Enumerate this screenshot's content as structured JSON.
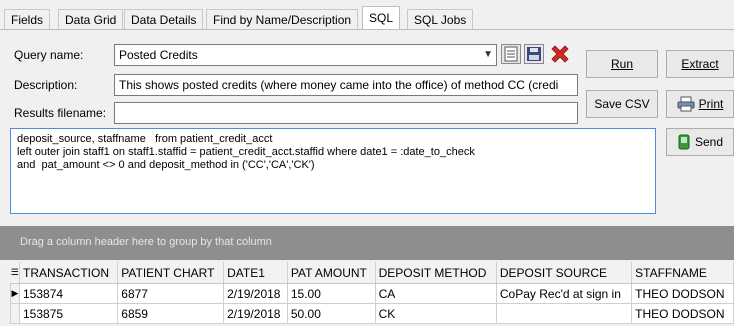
{
  "tabs": [
    {
      "label": "Fields"
    },
    {
      "label": "Data Grid"
    },
    {
      "label": "Data Details"
    },
    {
      "label": "Find by Name/Description"
    },
    {
      "label": "SQL"
    },
    {
      "label": "SQL Jobs"
    }
  ],
  "form": {
    "query_name_label": "Query name:",
    "query_name_value": "Posted Credits",
    "description_label": "Description:",
    "description_value": "This shows posted credits (where money came into the office) of method CC (credi",
    "results_filename_label": "Results filename:",
    "results_filename_value": ""
  },
  "buttons": {
    "run": "Run",
    "extract": "Extract",
    "save_csv": "Save CSV",
    "print": "Print",
    "send": "Send"
  },
  "sql_text": "deposit_source, staffname   from patient_credit_acct\nleft outer join staff1 on staff1.staffid = patient_credit_acct.staffid where date1 = :date_to_check\nand  pat_amount <> 0 and deposit_method in ('CC','CA','CK')",
  "group_hint": "Drag a column header here to group by that column",
  "grid": {
    "headers": [
      "TRANSACTION",
      "PATIENT CHART",
      "DATE1",
      "PAT AMOUNT",
      "DEPOSIT METHOD",
      "DEPOSIT SOURCE",
      "STAFFNAME"
    ],
    "rows": [
      [
        "153874",
        "6877",
        "2/19/2018",
        "15.00",
        "CA",
        "CoPay Rec'd at sign in",
        "THEO DODSON"
      ],
      [
        "153875",
        "6859",
        "2/19/2018",
        "50.00",
        "CK",
        "",
        "THEO DODSON"
      ]
    ]
  },
  "colors": {
    "accent_border": "#4d8fd6",
    "delete_red": "#d42a1f",
    "group_bar": "#8e8e8e",
    "send_green": "#3a9a3a"
  }
}
